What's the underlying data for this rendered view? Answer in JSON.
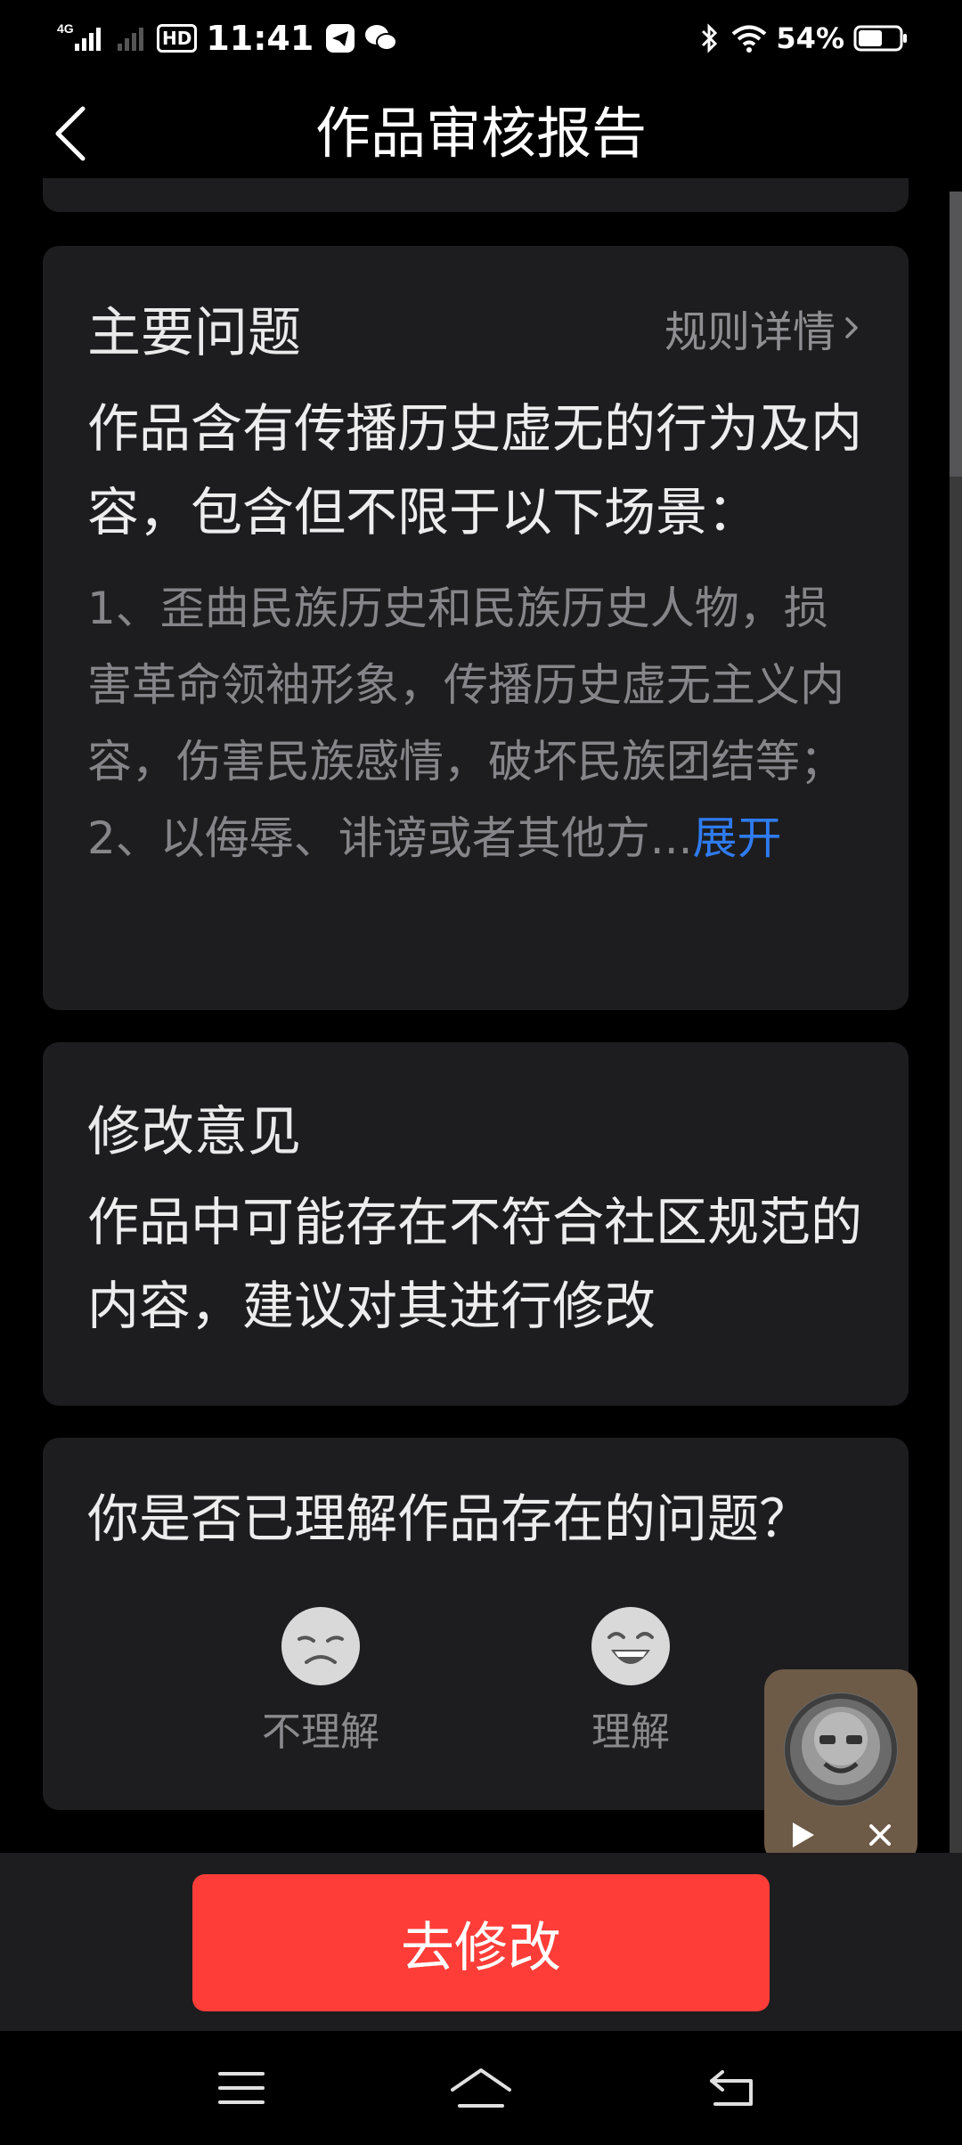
{
  "status_bar": {
    "network": "4G",
    "hd": "HD",
    "time": "11:41",
    "battery": "54%"
  },
  "header": {
    "title": "作品审核报告"
  },
  "issue_card": {
    "title": "主要问题",
    "rules_link": "规则详情",
    "main_text": "作品含有传播历史虚无的行为及内容，包含但不限于以下场景：",
    "detail_text": "1、歪曲民族历史和民族历史人物，损害革命领袖形象，传播历史虚无主义内容，伤害民族感情，破坏民族团结等；\n2、以侮辱、诽谤或者其他方...",
    "expand_label": "展开"
  },
  "suggestion_card": {
    "title": "修改意见",
    "text": "作品中可能存在不符合社区规范的内容，建议对其进行修改"
  },
  "question_card": {
    "question": "你是否已理解作品存在的问题？",
    "options": [
      {
        "label": "不理解",
        "icon": "unhappy-face-icon"
      },
      {
        "label": "理解",
        "icon": "laughing-face-icon"
      }
    ]
  },
  "primary_button": {
    "label": "去修改"
  },
  "colors": {
    "background": "#000000",
    "card": "#1d1d1f",
    "primary": "#fe3d38",
    "link": "#2f7bf0",
    "muted_text": "#85858a"
  }
}
